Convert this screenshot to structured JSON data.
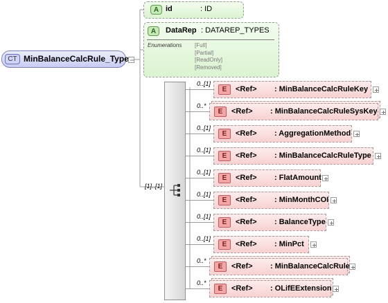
{
  "complex_type": {
    "badge": "CT",
    "name": "MinBalanceCalcRule_Type"
  },
  "attributes": [
    {
      "badge": "A",
      "name": "id",
      "type": ": ID"
    },
    {
      "badge": "A",
      "name": "DataRep",
      "type": ": DATAREP_TYPES",
      "enumerations_label": "Enumerations",
      "enumerations": [
        "[Full]",
        "[Partial]",
        "[ReadOnly]",
        "[Removed]"
      ]
    }
  ],
  "sequence": {
    "cardinality": "[1]..[1]",
    "icon": "sequence-compositor-icon"
  },
  "elements": [
    {
      "badge": "E",
      "ref": "<Ref>",
      "name": ": MinBalanceCalcRuleKey",
      "cardinality": "0..[1]"
    },
    {
      "badge": "E",
      "ref": "<Ref>",
      "name": ": MinBalanceCalcRuleSysKey",
      "cardinality": "0..*"
    },
    {
      "badge": "E",
      "ref": "<Ref>",
      "name": ": AggregationMethod",
      "cardinality": "0..[1]"
    },
    {
      "badge": "E",
      "ref": "<Ref>",
      "name": ": MinBalanceCalcRuleType",
      "cardinality": "0..[1]"
    },
    {
      "badge": "E",
      "ref": "<Ref>",
      "name": ": FlatAmount",
      "cardinality": "0..[1]"
    },
    {
      "badge": "E",
      "ref": "<Ref>",
      "name": ": MinMonthCOI",
      "cardinality": "0..[1]"
    },
    {
      "badge": "E",
      "ref": "<Ref>",
      "name": ": BalanceType",
      "cardinality": "0..[1]"
    },
    {
      "badge": "E",
      "ref": "<Ref>",
      "name": ": MinPct",
      "cardinality": "0..[1]"
    },
    {
      "badge": "E",
      "ref": "<Ref>",
      "name": ": MinBalanceCalcRule",
      "cardinality": "0..*"
    },
    {
      "badge": "E",
      "ref": "<Ref>",
      "name": ": OLifEExtension",
      "cardinality": "0..*"
    }
  ],
  "colors": {
    "ct_fill": "#c9ccf4",
    "attr_fill": "#daf3d0",
    "element_fill": "#f8d1d1",
    "line": "#9a9a9a"
  }
}
